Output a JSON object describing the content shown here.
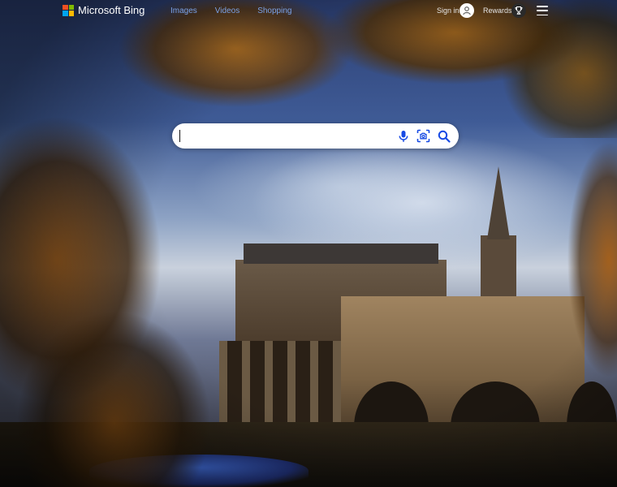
{
  "brand": {
    "name": "Microsoft Bing",
    "logo_colors": [
      "#f25022",
      "#7fba00",
      "#00a4ef",
      "#ffb900"
    ]
  },
  "nav": {
    "items": [
      {
        "label": "Images"
      },
      {
        "label": "Videos"
      },
      {
        "label": "Shopping"
      }
    ],
    "link_color": "#7aa2e8"
  },
  "account": {
    "signin_label": "Sign in",
    "rewards_label": "Rewards"
  },
  "search": {
    "value": "",
    "placeholder": "",
    "tools": [
      {
        "icon": "microphone-icon"
      },
      {
        "icon": "visual-search-icon"
      },
      {
        "icon": "search-icon"
      }
    ],
    "icon_color": "#174ae4"
  },
  "menu": {
    "icon": "hamburger-menu-icon"
  }
}
